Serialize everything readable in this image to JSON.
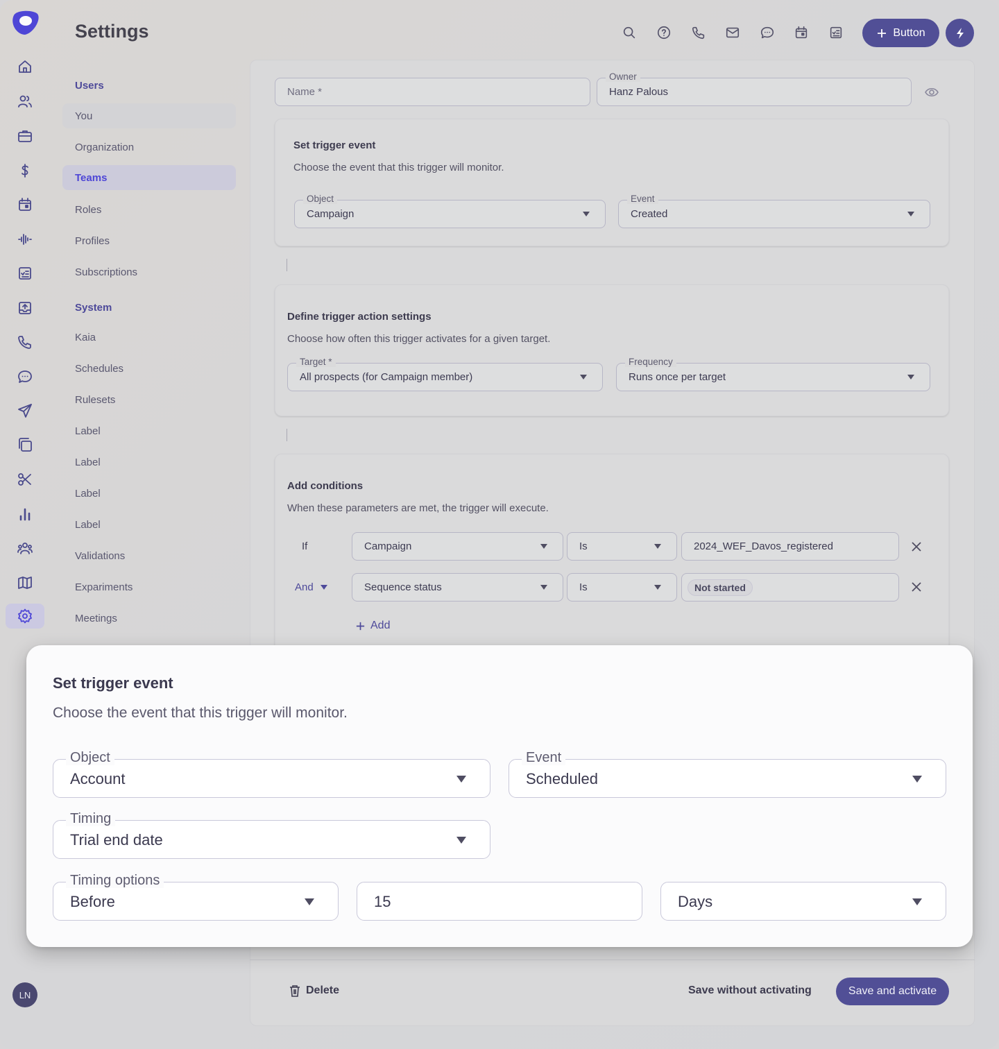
{
  "app": {
    "title": "Settings",
    "logo": "brand-logo"
  },
  "rail": {
    "icons": [
      "home-icon",
      "people-icon",
      "briefcase-icon",
      "dollar-icon",
      "calendar-icon",
      "waveform-icon",
      "task-list-icon",
      "inbox-upload-icon",
      "phone-icon",
      "chat-icon",
      "send-icon",
      "copy-icon",
      "scissors-icon",
      "bar-chart-icon",
      "team-icon",
      "map-icon",
      "gear-icon"
    ],
    "active": "gear-icon",
    "avatar_initials": "LN"
  },
  "nav": {
    "sections": [
      {
        "label": "Users",
        "items": [
          "You",
          "Organization",
          "Teams",
          "Roles",
          "Profiles",
          "Subscriptions"
        ]
      },
      {
        "label": "System",
        "items": [
          "Kaia",
          "Schedules",
          "Rulesets",
          "Label",
          "Label",
          "Label",
          "Label",
          "Validations",
          "Expariments",
          "Meetings"
        ]
      }
    ],
    "active_item": "Teams",
    "hover_item": "You"
  },
  "header": {
    "icons": [
      "search-icon",
      "help-icon",
      "phone-icon",
      "mail-icon",
      "chat-icon",
      "calendar-icon",
      "task-icon"
    ],
    "primary_button": "Button",
    "bolt_button": "bolt-icon"
  },
  "form": {
    "name": {
      "placeholder": "Name *",
      "value": ""
    },
    "owner": {
      "label": "Owner",
      "value": "Hanz Palous"
    },
    "trigger_event": {
      "title": "Set trigger event",
      "description": "Choose the event that this trigger will monitor.",
      "object": {
        "label": "Object",
        "value": "Campaign"
      },
      "event": {
        "label": "Event",
        "value": "Created"
      }
    },
    "action_settings": {
      "title": "Define trigger action settings",
      "description": "Choose how often this trigger activates for a given target.",
      "target": {
        "label": "Target *",
        "value": "All prospects (for Campaign member)"
      },
      "frequency": {
        "label": "Frequency",
        "value": "Runs once per target"
      }
    },
    "conditions": {
      "title": "Add conditions",
      "description": "When these parameters are met, the trigger will execute.",
      "rows": [
        {
          "connector": "If",
          "field": "Campaign",
          "operator": "Is",
          "value": "2024_WEF_Davos_registered",
          "value_is_chip": false
        },
        {
          "connector": "And",
          "field": "Sequence status",
          "operator": "Is",
          "value": "Not started",
          "value_is_chip": true
        }
      ],
      "add_label": "Add"
    }
  },
  "footer": {
    "delete_label": "Delete",
    "save_without_label": "Save without activating",
    "save_activate_label": "Save and activate"
  },
  "modal": {
    "title": "Set trigger event",
    "description": "Choose the event that this trigger will monitor.",
    "object": {
      "label": "Object",
      "value": "Account"
    },
    "event": {
      "label": "Event",
      "value": "Scheduled"
    },
    "timing": {
      "label": "Timing",
      "value": "Trial end date"
    },
    "timing_options": {
      "label": "Timing options",
      "value": "Before"
    },
    "amount": {
      "value": "15"
    },
    "unit": {
      "value": "Days"
    }
  },
  "colors": {
    "accent": "#514f96",
    "brand": "#4e46d6",
    "active_nav": "#4e46d6"
  }
}
